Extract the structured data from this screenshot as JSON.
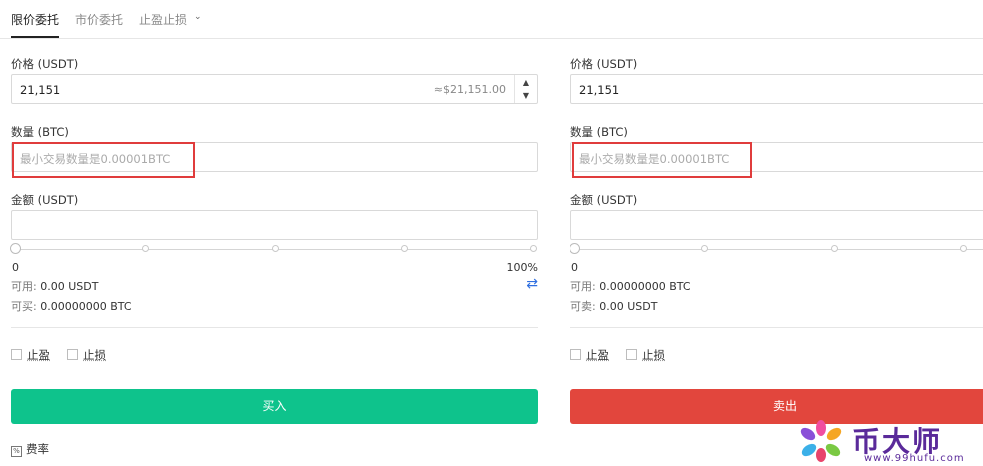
{
  "tabs": [
    {
      "label": "限价委托"
    },
    {
      "label": "市价委托"
    },
    {
      "label": "止盈止损"
    }
  ],
  "buy": {
    "price_label": "价格 (USDT)",
    "price_value": "21,151",
    "price_approx": "≈$21,151.00",
    "qty_label": "数量 (BTC)",
    "qty_placeholder": "最小交易数量是0.00001BTC",
    "amount_label": "金额 (USDT)",
    "slider_min": "0",
    "slider_max": "100%",
    "available_key": "可用:",
    "available_value": "0.00 USDT",
    "buyable_key": "可买:",
    "buyable_value": "0.00000000 BTC",
    "take_profit": "止盈",
    "stop_loss": "止损",
    "button": "买入",
    "fee": "费率",
    "button_color": "#0ec38c"
  },
  "sell": {
    "price_label": "价格 (USDT)",
    "price_value": "21,151",
    "qty_label": "数量 (BTC)",
    "qty_placeholder": "最小交易数量是0.00001BTC",
    "amount_label": "金额 (USDT)",
    "slider_min": "0",
    "available_key": "可用:",
    "available_value": "0.00000000 BTC",
    "sellable_key": "可卖:",
    "sellable_value": "0.00 USDT",
    "take_profit": "止盈",
    "stop_loss": "止损",
    "button": "卖出",
    "button_color": "#e2463d"
  },
  "watermark": {
    "name": "币大师",
    "url": "www.99hufu.com"
  }
}
